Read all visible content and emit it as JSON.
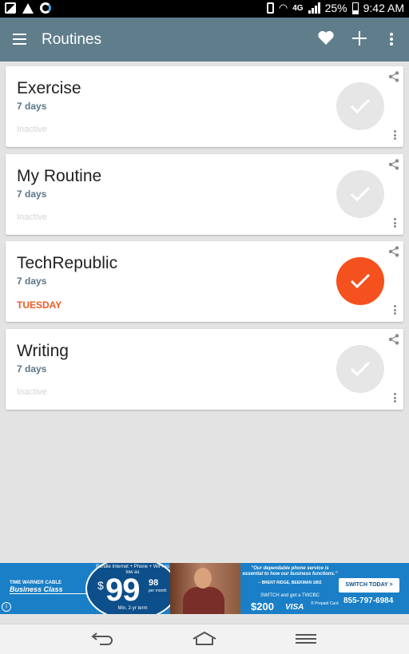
{
  "status_bar": {
    "network": "4G",
    "battery": "25%",
    "time": "9:42 AM",
    "icons": [
      "gallery-notification-icon",
      "warning-icon",
      "sync-icon",
      "vibrate-icon",
      "wifi-icon",
      "lte-icon",
      "signal-icon",
      "battery-icon"
    ]
  },
  "toolbar": {
    "title": "Routines",
    "icons": [
      "menu-icon",
      "heart-icon",
      "add-icon",
      "overflow-menu-icon"
    ]
  },
  "routines": [
    {
      "title": "Exercise",
      "days": "7 days",
      "status": "Inactive",
      "completed": false
    },
    {
      "title": "My Routine",
      "days": "7 days",
      "status": "Inactive",
      "completed": false
    },
    {
      "title": "TechRepublic",
      "days": "7 days",
      "status": "TUESDAY",
      "completed": true
    },
    {
      "title": "Writing",
      "days": "7 days",
      "status": "Inactive",
      "completed": false
    }
  ],
  "colors": {
    "toolbar": "#607d8b",
    "accent": "#f4511e",
    "days_text": "#5a7686",
    "inactive_check": "#e6e6e6",
    "background": "#e3e3e3"
  },
  "ad": {
    "brand_top": "TIME WARNER CABLE",
    "brand_main": "Business Class",
    "offer": "Bundle Internet + Phone + WiFi as low as",
    "dollar": "$",
    "price": "99",
    "cents": "98",
    "per_month": "per month",
    "term": "Min. 2-yr term",
    "quote": "\"Our dependable phone service is essential to how our business functions.\"",
    "quote_by": "– BRENT RIDGE, BEEKMAN 1802",
    "switch_text": "SWITCH and get a TWCBC",
    "reward": "$200",
    "visa": "VISA",
    "prepaid": "® Prepaid Card",
    "cta": "SWITCH TODAY >",
    "phone": "855-797-6984",
    "info": "i"
  },
  "nav_bar": {
    "buttons": [
      "back-icon",
      "home-icon",
      "recent-apps-icon"
    ]
  }
}
